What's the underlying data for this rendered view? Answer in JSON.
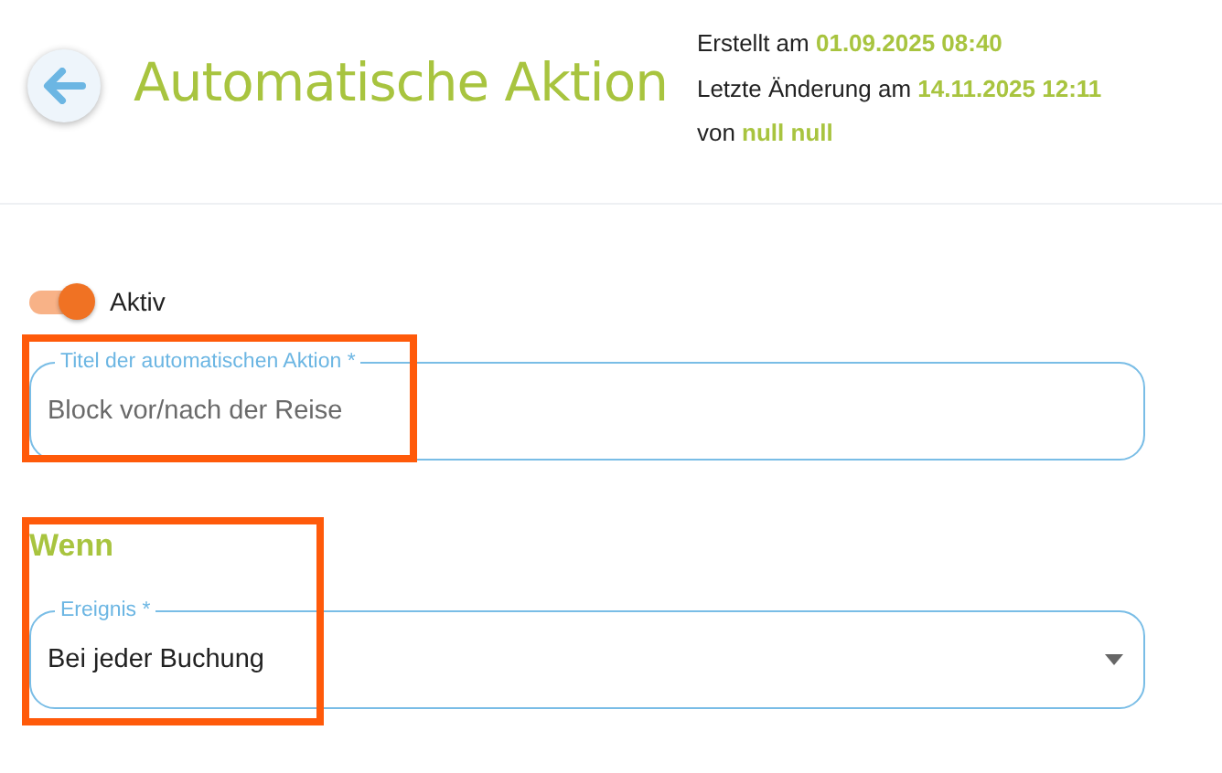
{
  "header": {
    "title": "Automatische Aktion",
    "meta": [
      {
        "label": "Erstellt am",
        "value": "01.09.2025 08:40"
      },
      {
        "label": "Letzte Änderung am",
        "value": "14.11.2025 12:11"
      },
      {
        "label": "von",
        "value": "null null"
      }
    ]
  },
  "active_toggle": {
    "label": "Aktiv",
    "on": true
  },
  "title_field": {
    "label": "Titel der automatischen Aktion *",
    "placeholder": "Block vor/nach der Reise"
  },
  "section": {
    "heading": "Wenn"
  },
  "event_field": {
    "label": "Ereignis *",
    "value": "Bei jeder Buchung"
  }
}
